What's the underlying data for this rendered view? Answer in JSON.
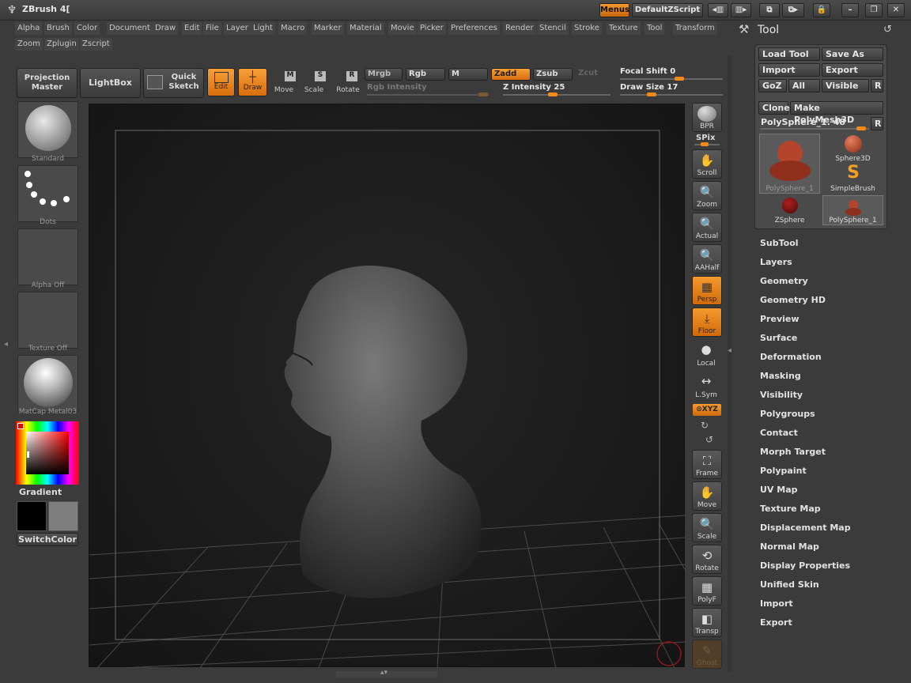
{
  "app": {
    "title": "ZBrush 4[",
    "menus_btn": "Menus",
    "script_btn": "DefaultZScript"
  },
  "menubar": {
    "items": [
      "Alpha",
      "Brush",
      "Color",
      "Document",
      "Draw",
      "Edit",
      "File",
      "Layer",
      "Light",
      "Macro",
      "Marker",
      "Material",
      "Movie",
      "Picker",
      "Preferences",
      "Render",
      "Stencil",
      "Stroke",
      "Texture",
      "Tool",
      "Transform",
      "Zoom",
      "Zplugin",
      "Zscript"
    ]
  },
  "toolbar": {
    "projection_master": "Projection Master",
    "lightbox": "LightBox",
    "quick_sketch": "Quick Sketch",
    "edit": "Edit",
    "draw": "Draw",
    "move": "Move",
    "scale": "Scale",
    "rotate": "Rotate",
    "move_key": "M",
    "scale_key": "S",
    "rotate_key": "R",
    "mrgb": "Mrgb",
    "rgb": "Rgb",
    "m": "M",
    "zadd": "Zadd",
    "zsub": "Zsub",
    "zcut": "Zcut",
    "rgb_intensity": "Rgb Intensity",
    "z_intensity_label": "Z Intensity",
    "z_intensity": "25",
    "z_intensity_fraction": 0.25,
    "focal_shift_label": "Focal Shift",
    "focal_shift": "0",
    "focal_shift_fraction": 0.5,
    "draw_size_label": "Draw Size",
    "draw_size": "17",
    "draw_size_fraction": 0.05
  },
  "left_shelf": {
    "brush": "Standard",
    "stroke": "Dots",
    "alpha": "Alpha  Off",
    "texture": "Texture  Off",
    "material": "MatCap  Metal03",
    "gradient": "Gradient",
    "switch_color": "SwitchColor"
  },
  "right_shelf": {
    "bpr": "BPR",
    "spix": "SPix",
    "scroll": "Scroll",
    "zoom": "Zoom",
    "actual": "Actual",
    "aahalf": "AAHalf",
    "persp": "Persp",
    "floor": "Floor",
    "local": "Local",
    "lsym": "L.Sym",
    "xyz": "⊙XYZ",
    "frame": "Frame",
    "move": "Move",
    "scale": "Scale",
    "rotate": "Rotate",
    "polyf": "PolyF",
    "transp": "Transp",
    "ghost": "Ghost"
  },
  "tool_palette": {
    "title": "Tool",
    "load_tool": "Load Tool",
    "save_as": "Save As",
    "import": "Import",
    "export": "Export",
    "goz": "GoZ",
    "all": "All",
    "visible": "Visible",
    "r": "R",
    "clone": "Clone",
    "make_polymesh": "Make PolyMesh3D",
    "current_tool": "PolySphere_1. 48",
    "thumbs": [
      "PolySphere_1",
      "Sphere3D",
      "SimpleBrush",
      "ZSphere",
      "PolySphere_1"
    ],
    "subpalettes": [
      "SubTool",
      "Layers",
      "Geometry",
      "Geometry HD",
      "Preview",
      "Surface",
      "Deformation",
      "Masking",
      "Visibility",
      "Polygroups",
      "Contact",
      "Morph Target",
      "Polypaint",
      "UV Map",
      "Texture Map",
      "Displacement Map",
      "Normal Map",
      "Display Properties",
      "Unified Skin",
      "Import",
      "Export"
    ]
  },
  "colors": {
    "accent": "#f28a18",
    "background": "#3b3b3b",
    "panel": "#4a4a4a"
  }
}
